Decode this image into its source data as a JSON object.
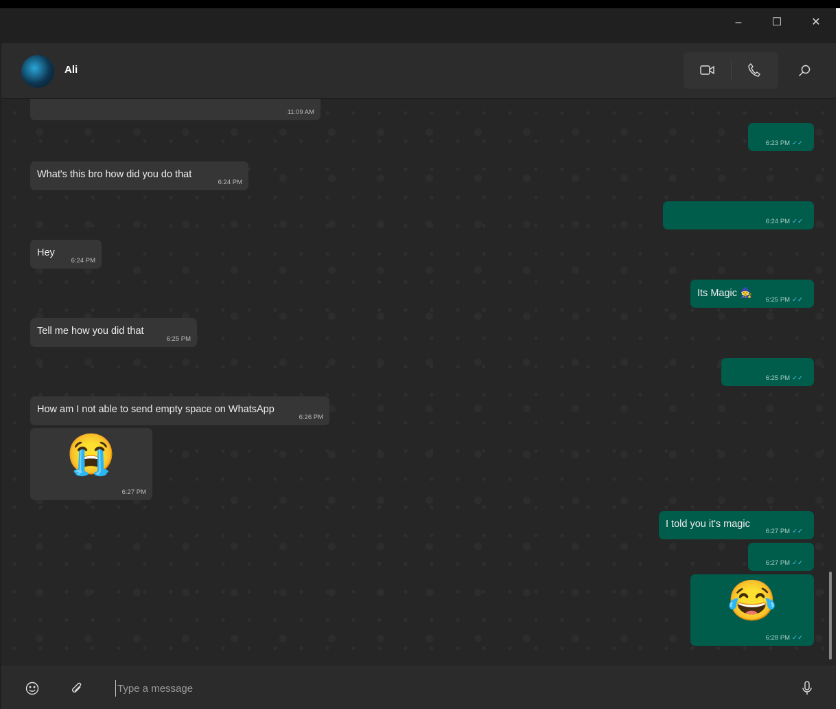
{
  "window": {
    "minimize": "–",
    "maximize": "☐",
    "close": "✕"
  },
  "contact": {
    "name": "Ali"
  },
  "icons": {
    "video": "video-camera-icon",
    "call": "phone-icon",
    "search": "search-icon",
    "emoji": "emoji-icon",
    "attach": "paperclip-icon",
    "mic": "microphone-icon"
  },
  "colors": {
    "outgoing": "#005c4b",
    "incoming": "#363636",
    "read_tick": "#53bdeb"
  },
  "messages": [
    {
      "dir": "in",
      "text": "",
      "time": "11:09 AM"
    },
    {
      "dir": "out",
      "text": "",
      "time": "6:23 PM",
      "ticks": "✓✓"
    },
    {
      "dir": "in",
      "text": "What's this bro how did you do that",
      "time": "6:24 PM"
    },
    {
      "dir": "out",
      "text": "",
      "time": "6:24 PM",
      "ticks": "✓✓"
    },
    {
      "dir": "in",
      "text": "Hey",
      "time": "6:24 PM"
    },
    {
      "dir": "out",
      "text": "Its Magic 🧙",
      "time": "6:25 PM",
      "ticks": "✓✓"
    },
    {
      "dir": "in",
      "text": "Tell me how you did that",
      "time": "6:25 PM"
    },
    {
      "dir": "out",
      "text": "",
      "time": "6:25 PM",
      "ticks": "✓✓"
    },
    {
      "dir": "in",
      "text": "How am I not able to send empty space on WhatsApp",
      "time": "6:26 PM"
    },
    {
      "dir": "in",
      "text": "😭",
      "time": "6:27 PM"
    },
    {
      "dir": "out",
      "text": "I told you it's magic",
      "time": "6:27 PM",
      "ticks": "✓✓"
    },
    {
      "dir": "out",
      "text": "",
      "time": "6:27 PM",
      "ticks": "✓✓"
    },
    {
      "dir": "out",
      "text": "😂",
      "time": "6:28 PM",
      "ticks": "✓✓"
    }
  ],
  "composer": {
    "placeholder": "Type a message"
  }
}
